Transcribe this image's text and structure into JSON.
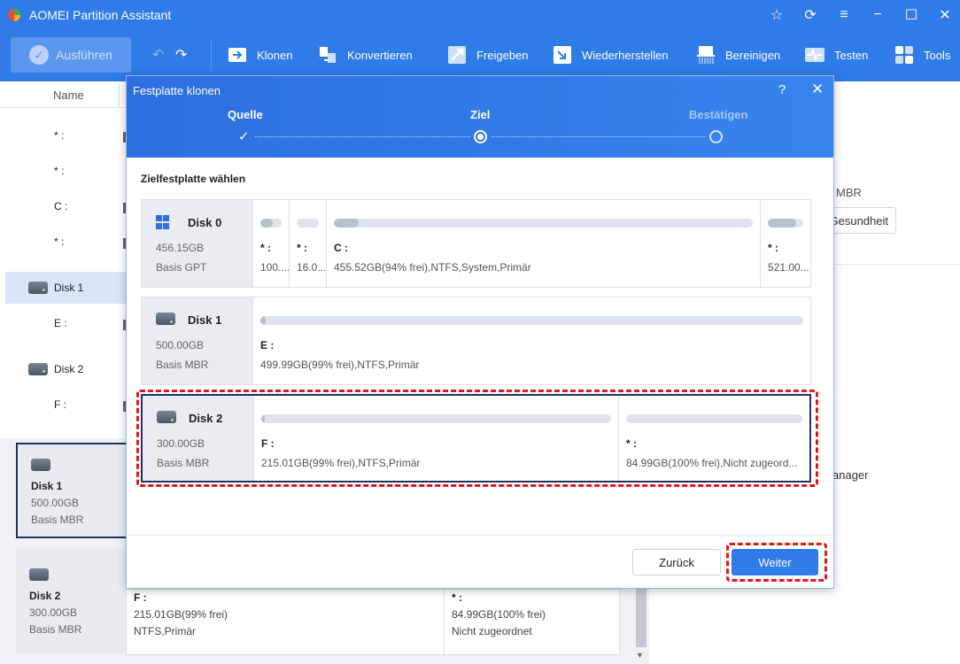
{
  "app": {
    "title": "AOMEI Partition Assistant"
  },
  "toolbar": {
    "run_label": "Ausführen",
    "items": [
      {
        "label": "Klonen",
        "icon": "clone-icon"
      },
      {
        "label": "Konvertieren",
        "icon": "convert-icon"
      },
      {
        "label": "Freigeben",
        "icon": "free-up-icon"
      },
      {
        "label": "Wiederherstellen",
        "icon": "recover-icon"
      },
      {
        "label": "Bereinigen",
        "icon": "wipe-icon"
      },
      {
        "label": "Testen",
        "icon": "test-icon"
      },
      {
        "label": "Tools",
        "icon": "tools-icon"
      }
    ]
  },
  "left_panel": {
    "column_name": "Name",
    "rows": [
      {
        "label": "* :"
      },
      {
        "label": "* :"
      },
      {
        "label": "C :"
      },
      {
        "label": "* :"
      },
      {
        "label": "Disk 1"
      },
      {
        "label": "E :"
      },
      {
        "label": "Disk 2"
      },
      {
        "label": "F :"
      }
    ],
    "cards": [
      {
        "name": "Disk 1",
        "size": "500.00GB",
        "type": "Basis MBR"
      },
      {
        "name": "Disk 2",
        "size": "300.00GB",
        "type": "Basis MBR"
      }
    ]
  },
  "bottom_partitions": [
    {
      "label": "F :",
      "size": "215.01GB(99% frei)",
      "info": "NTFS,Primär"
    },
    {
      "label": "* :",
      "size": "84.99GB(100% frei)",
      "info": "Nicht zugeordnet"
    }
  ],
  "right_panel": {
    "mbr": "MBR",
    "health_label": "Gesundheit",
    "manager_label": "anager"
  },
  "dialog": {
    "title": "Festplatte klonen",
    "steps": [
      {
        "label": "Quelle",
        "state": "done"
      },
      {
        "label": "Ziel",
        "state": "active"
      },
      {
        "label": "Bestätigen",
        "state": "pending"
      }
    ],
    "section_title": "Zielfestplatte wählen",
    "disks": [
      {
        "name": "Disk 0",
        "size": "456.15GB",
        "type": "Basis GPT",
        "icon": "windows-disk-icon",
        "partitions": [
          {
            "label": "* :",
            "info": "100....",
            "used": 0.6
          },
          {
            "label": "* :",
            "info": "16.0...",
            "used": 0.0
          },
          {
            "label": "C :",
            "info": "455.52GB(94% frei),NTFS,System,Primär",
            "used": 0.06
          },
          {
            "label": "* :",
            "info": "521.00...",
            "used": 0.8
          }
        ]
      },
      {
        "name": "Disk 1",
        "size": "500.00GB",
        "type": "Basis MBR",
        "icon": "disk-icon",
        "partitions": [
          {
            "label": "E :",
            "info": "499.99GB(99% frei),NTFS,Primär",
            "used": 0.01
          }
        ]
      },
      {
        "name": "Disk 2",
        "size": "300.00GB",
        "type": "Basis MBR",
        "icon": "disk-icon",
        "partitions": [
          {
            "label": "F :",
            "info": "215.01GB(99% frei),NTFS,Primär",
            "used": 0.01
          },
          {
            "label": "* :",
            "info": "84.99GB(100% frei),Nicht zugeord...",
            "used": 0.0
          }
        ]
      }
    ],
    "back_label": "Zurück",
    "next_label": "Weiter"
  },
  "colors": {
    "accent": "#2f7be8",
    "highlight": "#e0181d",
    "selected_border": "#20315e"
  }
}
